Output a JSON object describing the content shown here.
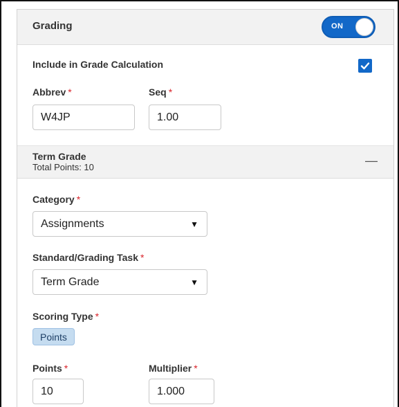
{
  "header": {
    "title": "Grading",
    "toggle_label": "ON"
  },
  "include": {
    "label": "Include in Grade Calculation",
    "checked": true
  },
  "abbrev": {
    "label": "Abbrev",
    "value": "W4JP"
  },
  "seq": {
    "label": "Seq",
    "value": "1.00"
  },
  "term": {
    "title": "Term Grade",
    "subtitle": "Total Points: 10",
    "collapse_symbol": "—"
  },
  "category": {
    "label": "Category",
    "value": "Assignments"
  },
  "standard": {
    "label": "Standard/Grading Task",
    "value": "Term Grade"
  },
  "scoring": {
    "label": "Scoring Type",
    "badge": "Points"
  },
  "points": {
    "label": "Points",
    "value": "10"
  },
  "multiplier": {
    "label": "Multiplier",
    "value": "1.000"
  },
  "required_marker": "*",
  "colors": {
    "accent": "#1268c8",
    "required": "#d9232a",
    "badge_bg": "#c5dcf0"
  }
}
